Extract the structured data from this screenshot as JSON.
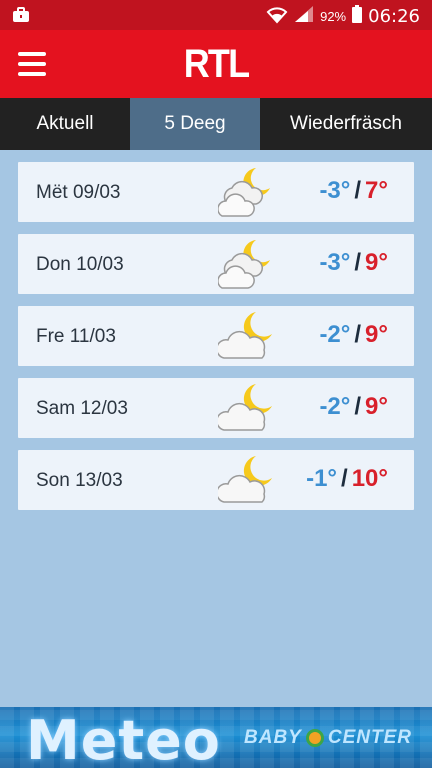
{
  "status_bar": {
    "battery": "92%",
    "time": "06:26"
  },
  "header": {
    "logo": "RTL"
  },
  "tabs": [
    {
      "label": "Aktuell",
      "active": false
    },
    {
      "label": "5 Deeg",
      "active": true
    },
    {
      "label": "Wiederfräsch",
      "active": false
    }
  ],
  "forecast": [
    {
      "day": "Mët 09/03",
      "icon": "cloudy-night-icon",
      "min": "-3°",
      "max": "7°"
    },
    {
      "day": "Don 10/03",
      "icon": "cloudy-night-icon",
      "min": "-3°",
      "max": "9°"
    },
    {
      "day": "Fre 11/03",
      "icon": "partly-cloudy-night-icon",
      "min": "-2°",
      "max": "9°"
    },
    {
      "day": "Sam 12/03",
      "icon": "partly-cloudy-night-icon",
      "min": "-2°",
      "max": "9°"
    },
    {
      "day": "Son 13/03",
      "icon": "partly-cloudy-night-icon",
      "min": "-1°",
      "max": "10°"
    }
  ],
  "separator": "/",
  "ad": {
    "title": "Meteo",
    "brand_left": "BABY",
    "brand_right": "CENTER"
  },
  "colors": {
    "header_red": "#e4121f",
    "min_temp": "#3d8fd1",
    "max_temp": "#d8202b",
    "active_tab": "#4e6d89"
  }
}
